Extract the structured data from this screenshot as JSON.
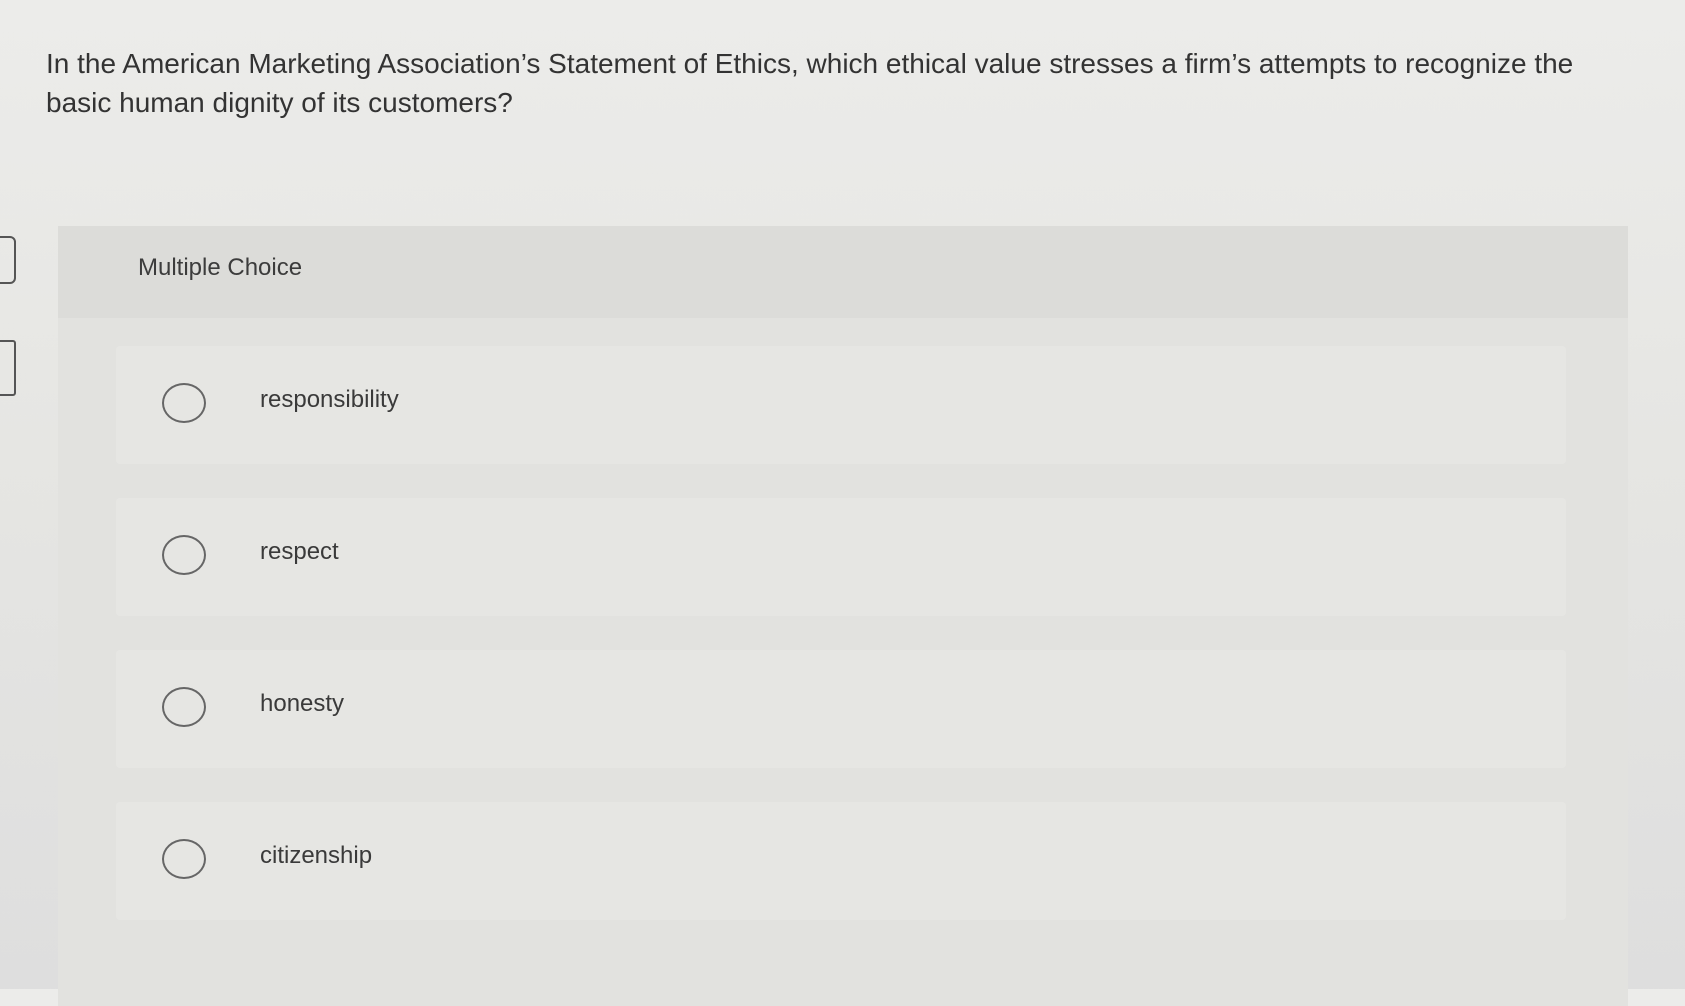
{
  "question": {
    "text": "In the American Marketing Association’s Statement of Ethics, which ethical value stresses a firm’s attempts to recognize the basic human dignity of its customers?"
  },
  "choice_block": {
    "title": "Multiple Choice",
    "options": [
      {
        "label": "responsibility"
      },
      {
        "label": "respect"
      },
      {
        "label": "honesty"
      },
      {
        "label": "citizenship"
      }
    ]
  }
}
